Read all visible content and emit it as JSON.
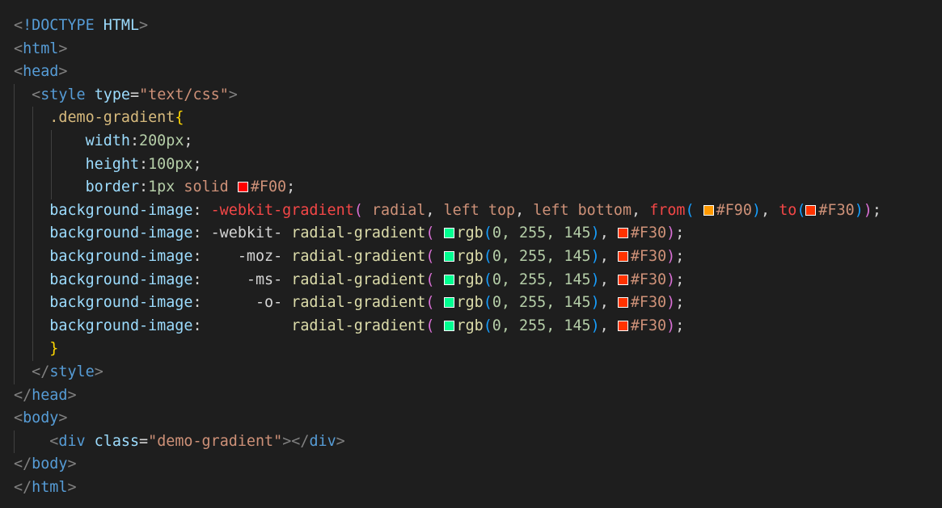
{
  "code": {
    "doctype": "!DOCTYPE",
    "doctype_name": "HTML",
    "html_tag": "html",
    "head_tag": "head",
    "style_tag": "style",
    "type_attr": "type",
    "type_value": "\"text/css\"",
    "selector": ".demo-gradient",
    "width_prop": "width",
    "width_val": "200px",
    "height_prop": "height",
    "height_val": "100px",
    "border_prop": "border",
    "border_num": "1px",
    "border_style": "solid",
    "border_color": "#F00",
    "bg_prop": "background-image",
    "webkit_gradient": "-webkit-gradient",
    "radial": "radial",
    "left_top": "left top",
    "left_bottom": "left bottom",
    "from_fn": "from",
    "from_color": "#F90",
    "to_fn": "to",
    "to_color": "#F30",
    "prefix_webkit": "-webkit-",
    "prefix_moz": "-moz-",
    "prefix_ms": "-ms-",
    "prefix_o": "-o-",
    "radial_gradient": "radial-gradient",
    "rgb_fn": "rgb",
    "rgb_values": "0, 255, 145",
    "end_color": "#F30",
    "body_tag": "body",
    "div_tag": "div",
    "class_attr": "class",
    "class_value": "\"demo-gradient\""
  },
  "swatch_colors": {
    "red": "#FF0000",
    "orange": "#FF9900",
    "red_orange": "#FF3300",
    "green": "#00FF91"
  }
}
